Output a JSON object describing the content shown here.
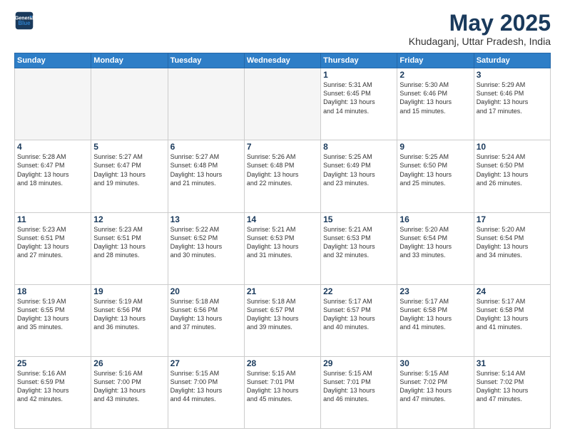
{
  "logo": {
    "line1": "General",
    "line2": "Blue"
  },
  "title": "May 2025",
  "location": "Khudaganj, Uttar Pradesh, India",
  "days_of_week": [
    "Sunday",
    "Monday",
    "Tuesday",
    "Wednesday",
    "Thursday",
    "Friday",
    "Saturday"
  ],
  "weeks": [
    [
      {
        "num": "",
        "text": ""
      },
      {
        "num": "",
        "text": ""
      },
      {
        "num": "",
        "text": ""
      },
      {
        "num": "",
        "text": ""
      },
      {
        "num": "1",
        "text": "Sunrise: 5:31 AM\nSunset: 6:45 PM\nDaylight: 13 hours\nand 14 minutes."
      },
      {
        "num": "2",
        "text": "Sunrise: 5:30 AM\nSunset: 6:46 PM\nDaylight: 13 hours\nand 15 minutes."
      },
      {
        "num": "3",
        "text": "Sunrise: 5:29 AM\nSunset: 6:46 PM\nDaylight: 13 hours\nand 17 minutes."
      }
    ],
    [
      {
        "num": "4",
        "text": "Sunrise: 5:28 AM\nSunset: 6:47 PM\nDaylight: 13 hours\nand 18 minutes."
      },
      {
        "num": "5",
        "text": "Sunrise: 5:27 AM\nSunset: 6:47 PM\nDaylight: 13 hours\nand 19 minutes."
      },
      {
        "num": "6",
        "text": "Sunrise: 5:27 AM\nSunset: 6:48 PM\nDaylight: 13 hours\nand 21 minutes."
      },
      {
        "num": "7",
        "text": "Sunrise: 5:26 AM\nSunset: 6:48 PM\nDaylight: 13 hours\nand 22 minutes."
      },
      {
        "num": "8",
        "text": "Sunrise: 5:25 AM\nSunset: 6:49 PM\nDaylight: 13 hours\nand 23 minutes."
      },
      {
        "num": "9",
        "text": "Sunrise: 5:25 AM\nSunset: 6:50 PM\nDaylight: 13 hours\nand 25 minutes."
      },
      {
        "num": "10",
        "text": "Sunrise: 5:24 AM\nSunset: 6:50 PM\nDaylight: 13 hours\nand 26 minutes."
      }
    ],
    [
      {
        "num": "11",
        "text": "Sunrise: 5:23 AM\nSunset: 6:51 PM\nDaylight: 13 hours\nand 27 minutes."
      },
      {
        "num": "12",
        "text": "Sunrise: 5:23 AM\nSunset: 6:51 PM\nDaylight: 13 hours\nand 28 minutes."
      },
      {
        "num": "13",
        "text": "Sunrise: 5:22 AM\nSunset: 6:52 PM\nDaylight: 13 hours\nand 30 minutes."
      },
      {
        "num": "14",
        "text": "Sunrise: 5:21 AM\nSunset: 6:53 PM\nDaylight: 13 hours\nand 31 minutes."
      },
      {
        "num": "15",
        "text": "Sunrise: 5:21 AM\nSunset: 6:53 PM\nDaylight: 13 hours\nand 32 minutes."
      },
      {
        "num": "16",
        "text": "Sunrise: 5:20 AM\nSunset: 6:54 PM\nDaylight: 13 hours\nand 33 minutes."
      },
      {
        "num": "17",
        "text": "Sunrise: 5:20 AM\nSunset: 6:54 PM\nDaylight: 13 hours\nand 34 minutes."
      }
    ],
    [
      {
        "num": "18",
        "text": "Sunrise: 5:19 AM\nSunset: 6:55 PM\nDaylight: 13 hours\nand 35 minutes."
      },
      {
        "num": "19",
        "text": "Sunrise: 5:19 AM\nSunset: 6:56 PM\nDaylight: 13 hours\nand 36 minutes."
      },
      {
        "num": "20",
        "text": "Sunrise: 5:18 AM\nSunset: 6:56 PM\nDaylight: 13 hours\nand 37 minutes."
      },
      {
        "num": "21",
        "text": "Sunrise: 5:18 AM\nSunset: 6:57 PM\nDaylight: 13 hours\nand 39 minutes."
      },
      {
        "num": "22",
        "text": "Sunrise: 5:17 AM\nSunset: 6:57 PM\nDaylight: 13 hours\nand 40 minutes."
      },
      {
        "num": "23",
        "text": "Sunrise: 5:17 AM\nSunset: 6:58 PM\nDaylight: 13 hours\nand 41 minutes."
      },
      {
        "num": "24",
        "text": "Sunrise: 5:17 AM\nSunset: 6:58 PM\nDaylight: 13 hours\nand 41 minutes."
      }
    ],
    [
      {
        "num": "25",
        "text": "Sunrise: 5:16 AM\nSunset: 6:59 PM\nDaylight: 13 hours\nand 42 minutes."
      },
      {
        "num": "26",
        "text": "Sunrise: 5:16 AM\nSunset: 7:00 PM\nDaylight: 13 hours\nand 43 minutes."
      },
      {
        "num": "27",
        "text": "Sunrise: 5:15 AM\nSunset: 7:00 PM\nDaylight: 13 hours\nand 44 minutes."
      },
      {
        "num": "28",
        "text": "Sunrise: 5:15 AM\nSunset: 7:01 PM\nDaylight: 13 hours\nand 45 minutes."
      },
      {
        "num": "29",
        "text": "Sunrise: 5:15 AM\nSunset: 7:01 PM\nDaylight: 13 hours\nand 46 minutes."
      },
      {
        "num": "30",
        "text": "Sunrise: 5:15 AM\nSunset: 7:02 PM\nDaylight: 13 hours\nand 47 minutes."
      },
      {
        "num": "31",
        "text": "Sunrise: 5:14 AM\nSunset: 7:02 PM\nDaylight: 13 hours\nand 47 minutes."
      }
    ]
  ]
}
